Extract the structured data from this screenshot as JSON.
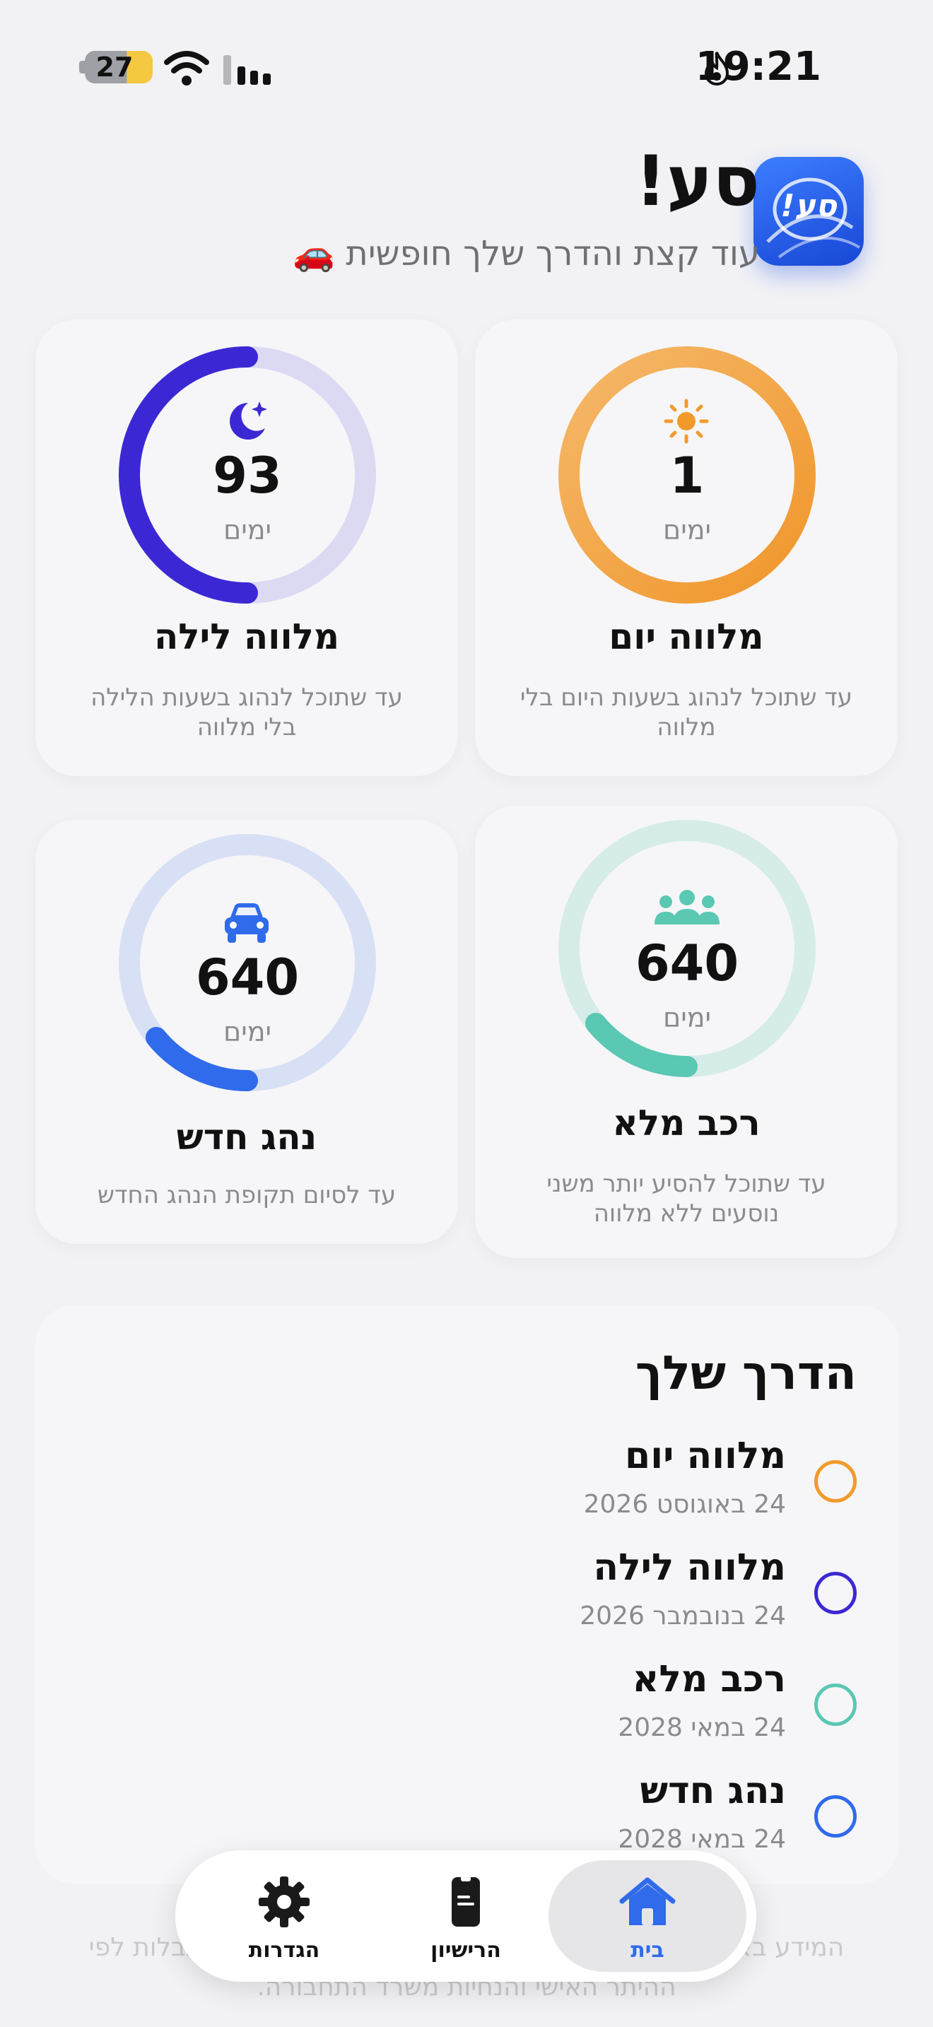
{
  "status_bar": {
    "time": "19:21",
    "battery": "27"
  },
  "header": {
    "title": "סע!",
    "subtitle": "עוד קצת והדרך שלך חופשית 🚗",
    "app_icon_text": "סע!"
  },
  "cards": [
    {
      "id": "day",
      "value": "1",
      "unit": "ימים",
      "title": "מלווה יום",
      "description": "עד שתוכל לנהוג בשעות היום בלי מלווה",
      "color": "#f19a2c",
      "track": "#f6b868",
      "icon": "sun-icon",
      "progress": 1.0
    },
    {
      "id": "night",
      "value": "93",
      "unit": "ימים",
      "title": "מלווה לילה",
      "description": "עד שתוכל לנהוג בשעות הלילה בלי מלווה",
      "color": "#3b28d4",
      "track": "#dcdaf3",
      "icon": "moon-stars-icon",
      "progress": 0.5
    },
    {
      "id": "full-car",
      "value": "640",
      "unit": "ימים",
      "title": "רכב מלא",
      "description": "עד שתוכל להסיע יותר משני נוסעים ללא מלווה",
      "color": "#5ac8b3",
      "track": "#d6ece8",
      "icon": "people-icon",
      "progress": 0.1
    },
    {
      "id": "new-driver",
      "value": "640",
      "unit": "ימים",
      "title": "נהג חדש",
      "description": "עד לסיום תקופת הנהג החדש",
      "color": "#2f6bea",
      "track": "#d8e0f5",
      "icon": "car-icon",
      "progress": 0.1
    }
  ],
  "timeline": {
    "title": "הדרך שלך",
    "items": [
      {
        "name": "מלווה יום",
        "date": "24 באוגוסט 2026",
        "color": "#f19a2c"
      },
      {
        "name": "מלווה לילה",
        "date": "24 בנובמבר 2026",
        "color": "#3b28d4"
      },
      {
        "name": "רכב מלא",
        "date": "24 במאי 2028",
        "color": "#5ac8b3"
      },
      {
        "name": "נהג חדש",
        "date": "24 במאי 2028",
        "color": "#2f6bea"
      }
    ]
  },
  "footer_note": "המידע באפליקציה הוא כללי ונועד לעזור לך לעקוב אחר ההגבלות לפי ההיתר האישי והנחיות משרד התחבורה.",
  "tabbar": {
    "tabs": [
      {
        "label": "בית",
        "icon": "house-icon",
        "active": true
      },
      {
        "label": "הרישיון",
        "icon": "license-icon",
        "active": false
      },
      {
        "label": "הגדרות",
        "icon": "gear-icon",
        "active": false
      }
    ]
  }
}
